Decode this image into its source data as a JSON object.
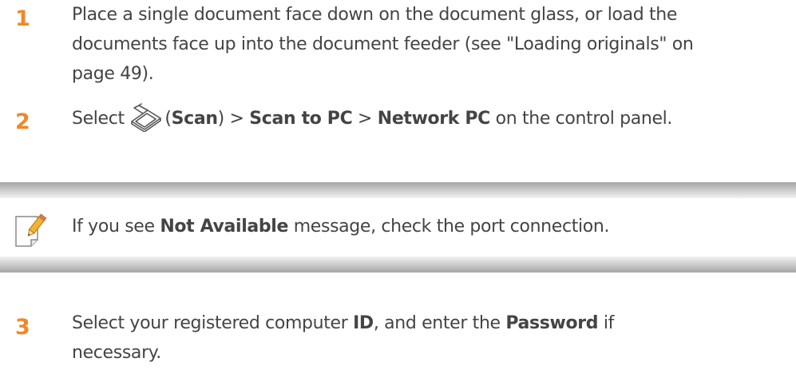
{
  "colors": {
    "step_number": "#f0882a",
    "body_text": "#444444",
    "note_bar": "#b5b5b5"
  },
  "steps": [
    {
      "number": "1",
      "line1": "Place a single document face down on the document glass, or load the",
      "line2": "documents face up into the document feeder (see \"Loading originals\" on",
      "line3": "page 49)."
    },
    {
      "number": "2",
      "select": "Select ",
      "paren_open": "(",
      "scan": "Scan",
      "paren_close_sep": ") > ",
      "scan_to_pc": "Scan to PC",
      "sep": " > ",
      "network_pc": "Network PC",
      "tail": " on the control panel.",
      "icon": "scan-icon"
    },
    {
      "number": "3",
      "select": "Select your registered computer ",
      "id": "ID",
      "mid": ", and enter the ",
      "password": "Password",
      "tail": " if",
      "line2": "necessary."
    }
  ],
  "note": {
    "icon": "note-pencil-icon",
    "prefix": "If you see ",
    "bold": "Not Available",
    "suffix": " message, check the port connection."
  }
}
